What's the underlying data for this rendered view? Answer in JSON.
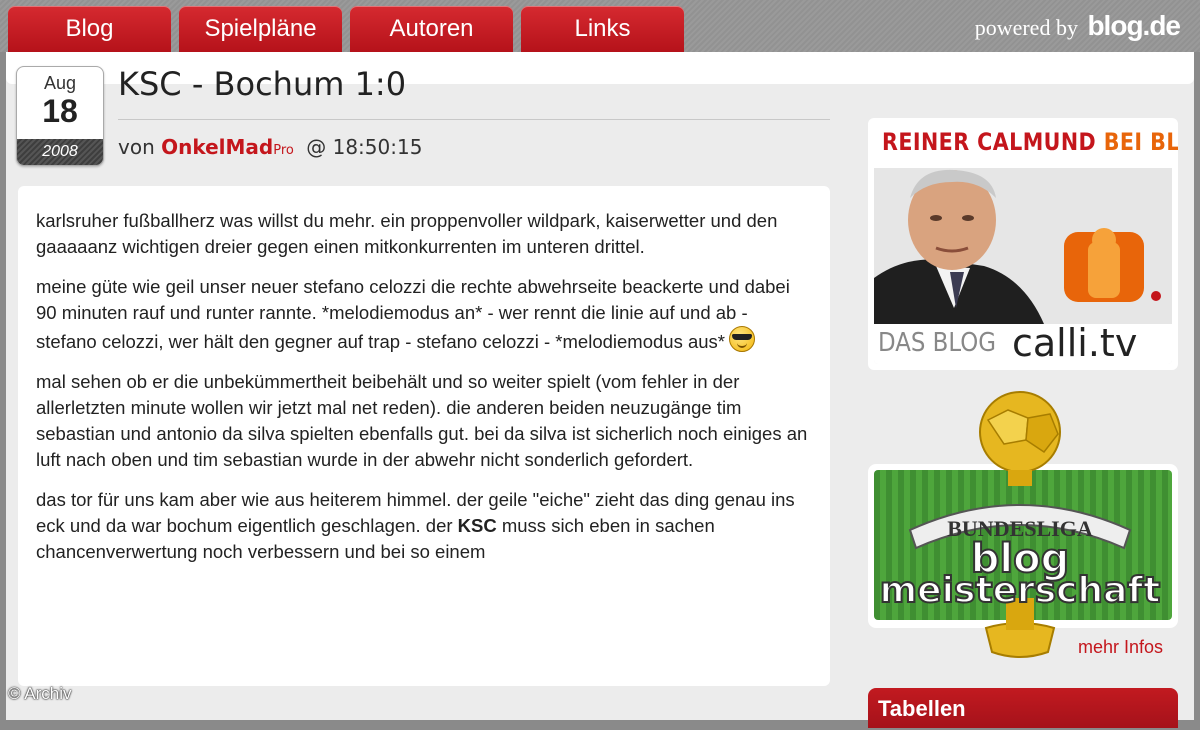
{
  "nav": {
    "tabs": [
      {
        "label": "Blog"
      },
      {
        "label": "Spielpläne"
      },
      {
        "label": "Autoren"
      },
      {
        "label": "Links"
      }
    ],
    "powered_by_text": "powered by",
    "powered_by_brand": "blog.de"
  },
  "post": {
    "date": {
      "month": "Aug",
      "day": "18",
      "year": "2008"
    },
    "title": "KSC - Bochum 1:0",
    "byline": {
      "prefix": "von",
      "author": "OnkelMad",
      "author_badge": "Pro",
      "separator": "@",
      "time": "18:50:15"
    },
    "paragraphs": [
      "karlsruher fußballherz was willst du mehr. ein proppenvoller wildpark, kaiserwetter und den gaaaaanz wichtigen dreier gegen einen mitkonkurrenten im unteren drittel.",
      "meine güte wie geil unser neuer stefano celozzi die rechte abwehrseite beackerte und dabei 90 minuten rauf und runter rannte. *melodiemodus an* - wer rennt die linie auf und ab - stefano celozzi, wer hält den gegner auf trap - stefano celozzi - *melodiemodus aus*",
      "mal sehen ob er die unbekümmertheit beibehält und so weiter spielt (vom fehler in der allerletzten minute wollen wir jetzt mal net reden). die anderen beiden neuzugänge tim sebastian und antonio da silva spielten ebenfalls gut. bei da silva ist sicherlich noch einiges an luft nach oben und tim sebastian wurde in der abwehr nicht sonderlich gefordert."
    ],
    "paragraph4": {
      "before": "das tor für uns kam aber wie aus heiterem himmel. der geile \"eiche\" zieht das ding genau ins eck und da war bochum eigentlich geschlagen. der",
      "bold": "KSC",
      "after": "muss sich eben in sachen chancenverwertung noch verbessern und bei so einem"
    }
  },
  "sidebar": {
    "calli_ad": {
      "headline_red": "REINER CALMUND",
      "headline_orange": "BEI BLOG.DE",
      "footer_left": "DAS BLOG",
      "footer_right": "calli.tv"
    },
    "meisterschaft": {
      "line1": "BUNDESLIGA",
      "line2": "blog",
      "line3": "meisterschaft",
      "more_link": "mehr Infos"
    },
    "tabellen_header": "Tabellen"
  },
  "watermark": "© Archiv",
  "colors": {
    "nav_red": "#c4161c",
    "accent_orange": "#e8650a",
    "frame_gray": "#8a8a8a"
  }
}
